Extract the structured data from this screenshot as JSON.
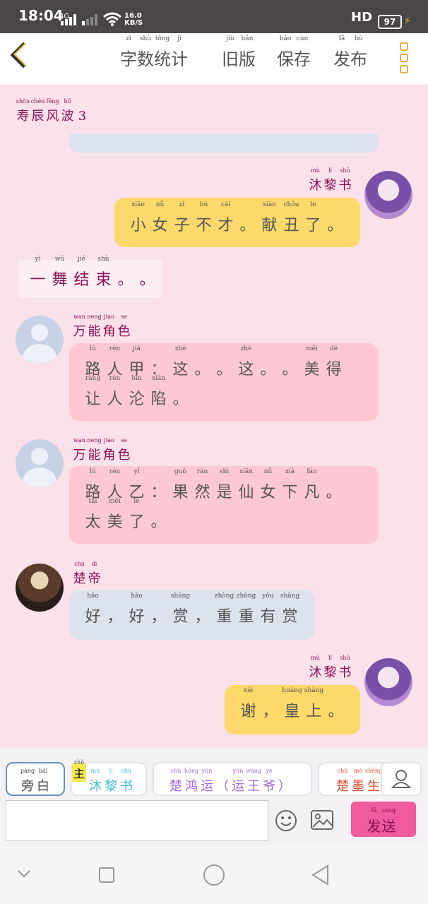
{
  "status_bar": {
    "time": "18:04",
    "network": "4G",
    "speed_value": "16.0",
    "speed_unit": "KB/S",
    "hd": "HD",
    "battery": "97"
  },
  "header": {
    "items": [
      {
        "chars": [
          "字",
          "数",
          "统",
          "计"
        ],
        "pinyin": [
          "zì",
          "shù",
          "tǒng",
          "jì"
        ]
      },
      {
        "chars": [
          "旧",
          "版"
        ],
        "pinyin": [
          "jiù",
          "bǎn"
        ]
      },
      {
        "chars": [
          "保",
          "存"
        ],
        "pinyin": [
          "bǎo",
          "cún"
        ]
      },
      {
        "chars": [
          "发",
          "布"
        ],
        "pinyin": [
          "fā",
          "bù"
        ]
      }
    ]
  },
  "chapter_title": {
    "chars": [
      "寿",
      "辰",
      "风",
      "波",
      "3"
    ],
    "pinyin": [
      "shòu",
      "chén",
      "fēng",
      "bō",
      ""
    ]
  },
  "messages": [
    {
      "side": "right",
      "name": {
        "chars": [
          "沐",
          "黎",
          "书"
        ],
        "pinyin": [
          "mù",
          "lí",
          "shū"
        ]
      },
      "lines": [
        {
          "chars": [
            "小",
            "女",
            "子",
            "不",
            "才",
            "。",
            "献",
            "丑",
            "了",
            "。"
          ],
          "pinyin": [
            "xiǎo",
            "nǚ",
            "zǐ",
            "bù",
            "cái",
            "",
            "xiàn",
            "chǒu",
            "le",
            ""
          ]
        }
      ]
    },
    {
      "side": "narration",
      "lines": [
        {
          "chars": [
            "一",
            "舞",
            "结",
            "束",
            "。",
            "。"
          ],
          "pinyin": [
            "yī",
            "wǔ",
            "jié",
            "shù",
            "",
            ""
          ]
        }
      ]
    },
    {
      "side": "left",
      "name": {
        "chars": [
          "万",
          "能",
          "角",
          "色"
        ],
        "pinyin": [
          "wan",
          "neng",
          "jiao",
          "se"
        ]
      },
      "lines": [
        {
          "chars": [
            "路",
            "人",
            "甲",
            "：",
            "这",
            "。",
            "。",
            "这",
            "。",
            "。",
            "美",
            "得"
          ],
          "pinyin": [
            "lù",
            "rén",
            "jiǎ",
            "",
            "zhè",
            "",
            "",
            "zhè",
            "",
            "",
            "měi",
            "dé"
          ]
        },
        {
          "chars": [
            "让",
            "人",
            "沦",
            "陷",
            "。"
          ],
          "pinyin": [
            "ràng",
            "rén",
            "lún",
            "xiàn",
            ""
          ]
        }
      ]
    },
    {
      "side": "left",
      "name": {
        "chars": [
          "万",
          "能",
          "角",
          "色"
        ],
        "pinyin": [
          "wan",
          "neng",
          "jiao",
          "se"
        ]
      },
      "lines": [
        {
          "chars": [
            "路",
            "人",
            "乙",
            "：",
            "果",
            "然",
            "是",
            "仙",
            "女",
            "下",
            "凡",
            "。"
          ],
          "pinyin": [
            "lù",
            "rén",
            "yǐ",
            "",
            "guǒ",
            "rán",
            "shì",
            "xiān",
            "nǚ",
            "xià",
            "fán",
            ""
          ]
        },
        {
          "chars": [
            "太",
            "美",
            "了",
            "。"
          ],
          "pinyin": [
            "tài",
            "měi",
            "le",
            ""
          ]
        }
      ]
    },
    {
      "side": "left",
      "name": {
        "chars": [
          "楚",
          "帝"
        ],
        "pinyin": [
          "chu",
          "di"
        ]
      },
      "lines": [
        {
          "chars": [
            "好",
            "，",
            "好",
            "，",
            "赏",
            "，",
            "重",
            "重",
            "有",
            "赏"
          ],
          "pinyin": [
            "hǎo",
            "",
            "hǎo",
            "",
            "shǎng",
            "",
            "zhòng",
            "zhòng",
            "yǒu",
            "shǎng"
          ]
        }
      ]
    },
    {
      "side": "right",
      "name": {
        "chars": [
          "沐",
          "黎",
          "书"
        ],
        "pinyin": [
          "mù",
          "lí",
          "shū"
        ]
      },
      "lines": [
        {
          "chars": [
            "谢",
            "，",
            "皇",
            "上",
            "。"
          ],
          "pinyin": [
            "xiè",
            "",
            "huáng",
            "shàng",
            ""
          ]
        }
      ]
    }
  ],
  "character_chips": [
    {
      "chars": [
        "旁",
        "白"
      ],
      "pinyin": [
        "páng",
        "bái"
      ],
      "color": "#444444",
      "selected": true
    },
    {
      "badge": "主",
      "badge_pinyin": "zhǔ",
      "chars": [
        "沐",
        "黎",
        "书"
      ],
      "pinyin": [
        "mù",
        "lí",
        "shū"
      ],
      "color": "#3bbfc9"
    },
    {
      "chars": [
        "楚",
        "鸿",
        "运",
        "（",
        "运",
        "王",
        "爷",
        "）"
      ],
      "pinyin": [
        "chǔ",
        "hóng",
        "yùn",
        "",
        "yùn",
        "wáng",
        "yé",
        ""
      ],
      "color": "#a36ad6"
    },
    {
      "chars": [
        "楚",
        "墨",
        "生"
      ],
      "pinyin": [
        "chǔ",
        "mò",
        "shēng"
      ],
      "color": "#e0462f"
    }
  ],
  "input": {
    "placeholder": ""
  },
  "send_button": {
    "chars": [
      "发",
      "送"
    ],
    "pinyin": [
      "fā",
      "sòng"
    ]
  },
  "colors": {
    "accent": "#ef5b9c",
    "bubble_yellow": "#fdd86b",
    "bubble_pink": "#fdc7d3",
    "bubble_gray": "#dde3ec",
    "name": "#8b1054"
  }
}
